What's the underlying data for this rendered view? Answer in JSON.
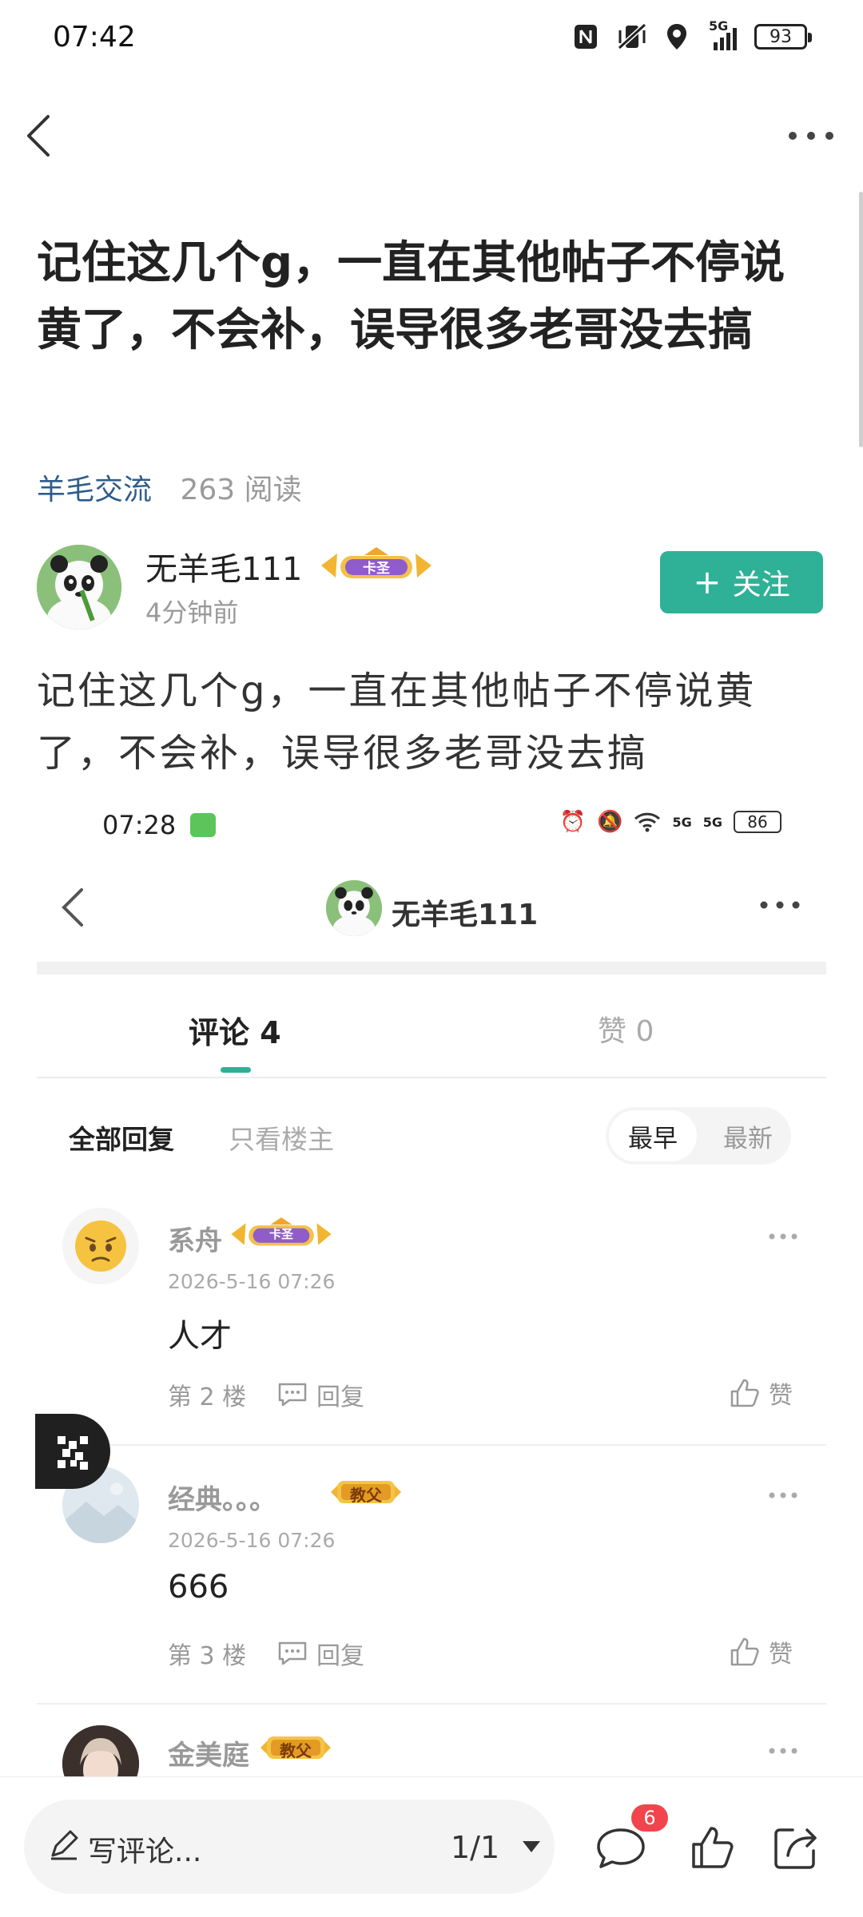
{
  "status_bar": {
    "time": "07:42",
    "signal": "5G",
    "battery": "93"
  },
  "post": {
    "title": "记住这几个g，一直在其他帖子不停说黄了，不会补，误导很多老哥没去搞",
    "tag": "羊毛交流",
    "reads": "263 阅读",
    "author": {
      "name": "无羊毛111",
      "badge": "卡圣",
      "time": "4分钟前"
    },
    "follow_label": "关注",
    "body": "记住这几个g，一直在其他帖子不停说黄了，不会补，误导很多老哥没去搞"
  },
  "screenshot": {
    "status": {
      "time": "07:28",
      "battery": "86",
      "signal1": "5G",
      "signal2": "5G"
    },
    "header_name": "无羊毛111",
    "tabs": [
      {
        "label": "评论 4"
      },
      {
        "label": "赞 0"
      }
    ],
    "filters": {
      "all": "全部回复",
      "op_only": "只看楼主"
    },
    "sort": {
      "oldest": "最早",
      "newest": "最新"
    },
    "comments": [
      {
        "name": "系舟",
        "badge": "卡圣",
        "date": "2026-5-16 07:26",
        "text": "人才",
        "floor": "第 2 楼",
        "reply": "回复",
        "like": "赞"
      },
      {
        "name": "经典。。。",
        "badge": "教父",
        "date": "2026-5-16 07:26",
        "text": "666",
        "floor": "第 3 楼",
        "reply": "回复",
        "like": "赞"
      },
      {
        "name": "金美庭",
        "badge": "教父"
      }
    ]
  },
  "bottom_bar": {
    "comment_placeholder": "写评论...",
    "page": "1/1",
    "comment_count": "6"
  },
  "colors": {
    "accent": "#2eb196",
    "tag": "#2e5c8a",
    "badge_red": "#f2444d"
  }
}
